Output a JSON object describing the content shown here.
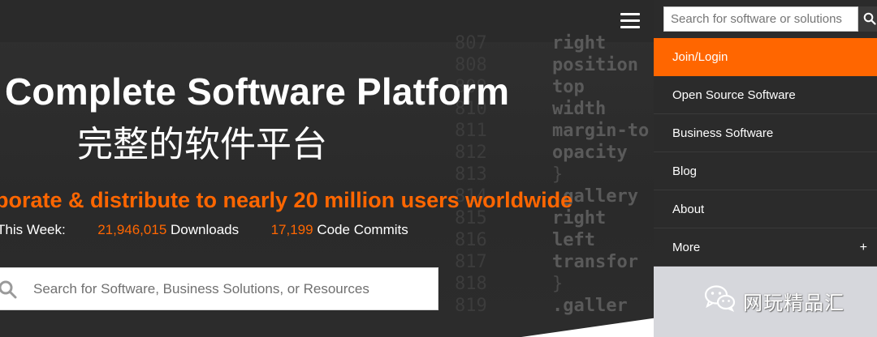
{
  "header": {
    "menu_icon": "hamburger-icon"
  },
  "hero": {
    "title": "Complete Software Platform",
    "subtitle": "完整的软件平台",
    "tagline": "borate & distribute to nearly 20 million users worldwide",
    "stats": {
      "label": "This Week:",
      "downloads_value": "21,946,015",
      "downloads_label": "Downloads",
      "commits_value": "17,199",
      "commits_label": "Code Commits"
    },
    "search": {
      "placeholder": "Search for Software, Business Solutions, or Resources",
      "icon": "search-icon"
    }
  },
  "sidemenu": {
    "search": {
      "placeholder": "Search for software or solutions",
      "icon": "search-icon"
    },
    "items": [
      {
        "label": "Join/Login",
        "active": true
      },
      {
        "label": "Open Source Software"
      },
      {
        "label": "Business Software"
      },
      {
        "label": "Blog"
      },
      {
        "label": "About"
      },
      {
        "label": "More",
        "expand": "+"
      }
    ]
  },
  "watermark": {
    "text": "网玩精品汇",
    "icon": "wechat-icon"
  },
  "colors": {
    "accent": "#ff6600",
    "background": "#2f2f2f",
    "menu_bg": "#2b2b2b"
  }
}
